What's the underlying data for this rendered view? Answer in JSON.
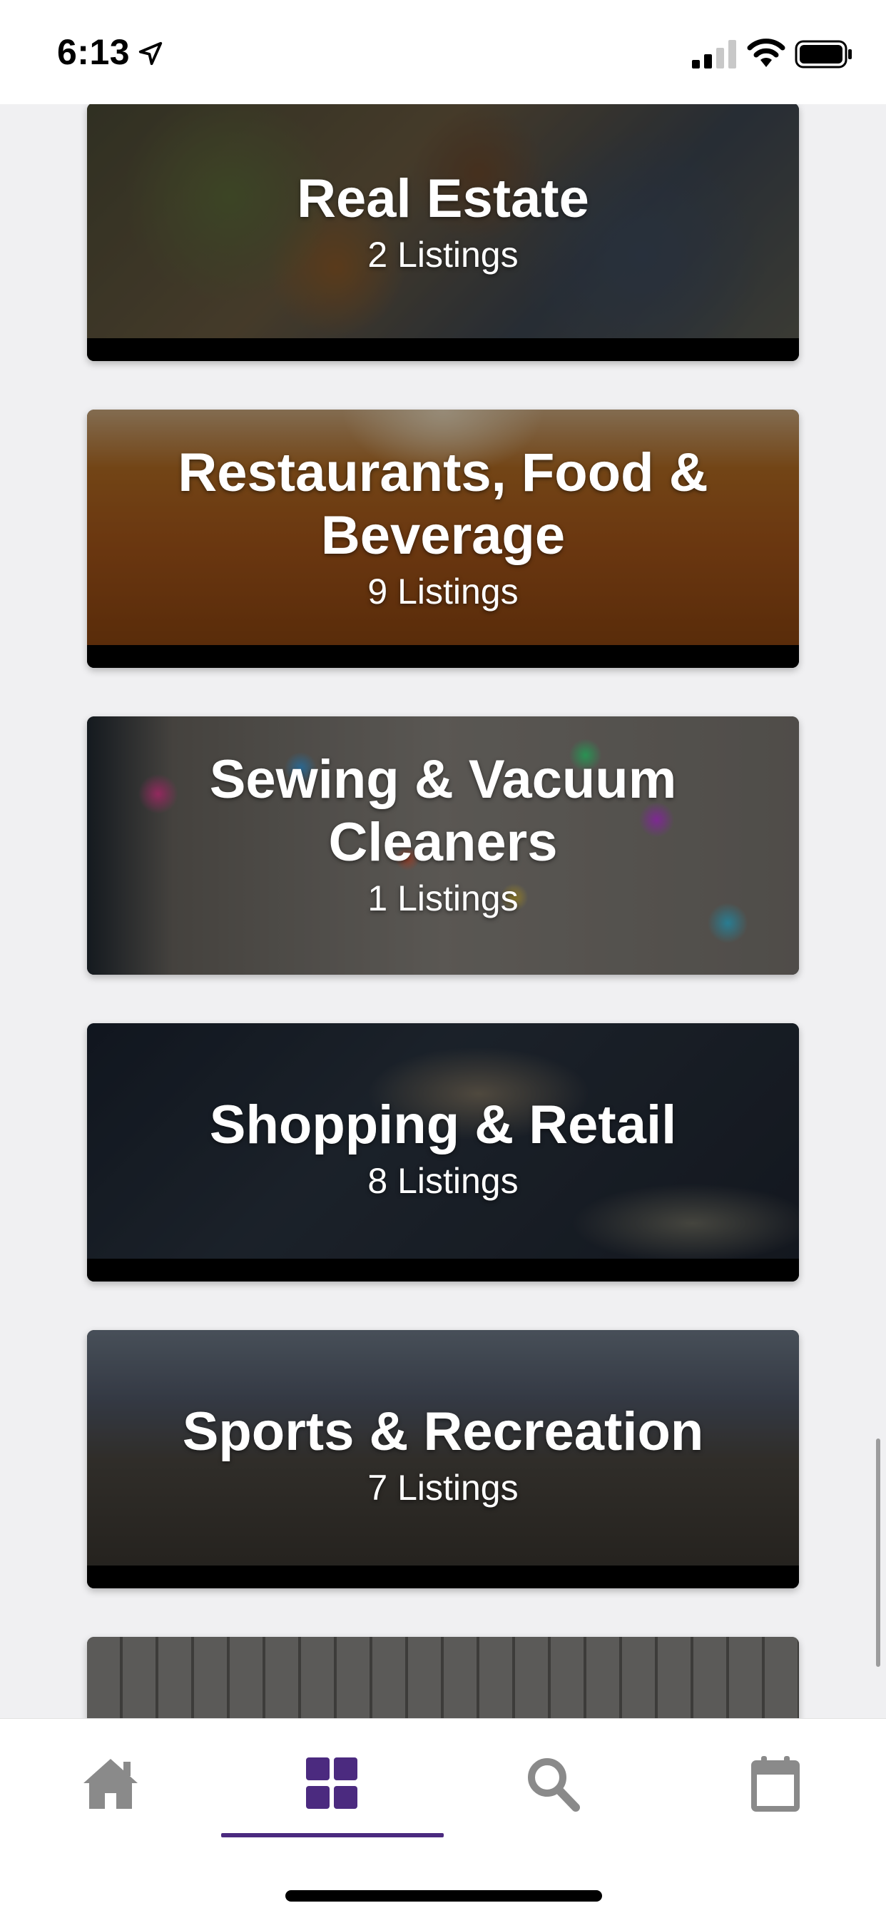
{
  "status_bar": {
    "time": "6:13",
    "icons": [
      "location-arrow-icon",
      "cellular-signal-icon",
      "wifi-icon",
      "battery-icon"
    ]
  },
  "categories": [
    {
      "title": "Real Estate",
      "count": "2 Listings"
    },
    {
      "title": "Restaurants, Food & Beverage",
      "count": "9 Listings"
    },
    {
      "title": "Sewing & Vacuum Cleaners",
      "count": "1 Listings"
    },
    {
      "title": "Shopping & Retail",
      "count": "8 Listings"
    },
    {
      "title": "Sports & Recreation",
      "count": "7 Listings"
    }
  ],
  "tab_bar": {
    "tabs": [
      {
        "icon": "home-icon",
        "selected": false
      },
      {
        "icon": "grid-icon",
        "selected": true
      },
      {
        "icon": "search-icon",
        "selected": false
      },
      {
        "icon": "calendar-icon",
        "selected": false
      }
    ],
    "inactive_color": "#8a8a8a",
    "active_color": "#4b2a7f"
  }
}
